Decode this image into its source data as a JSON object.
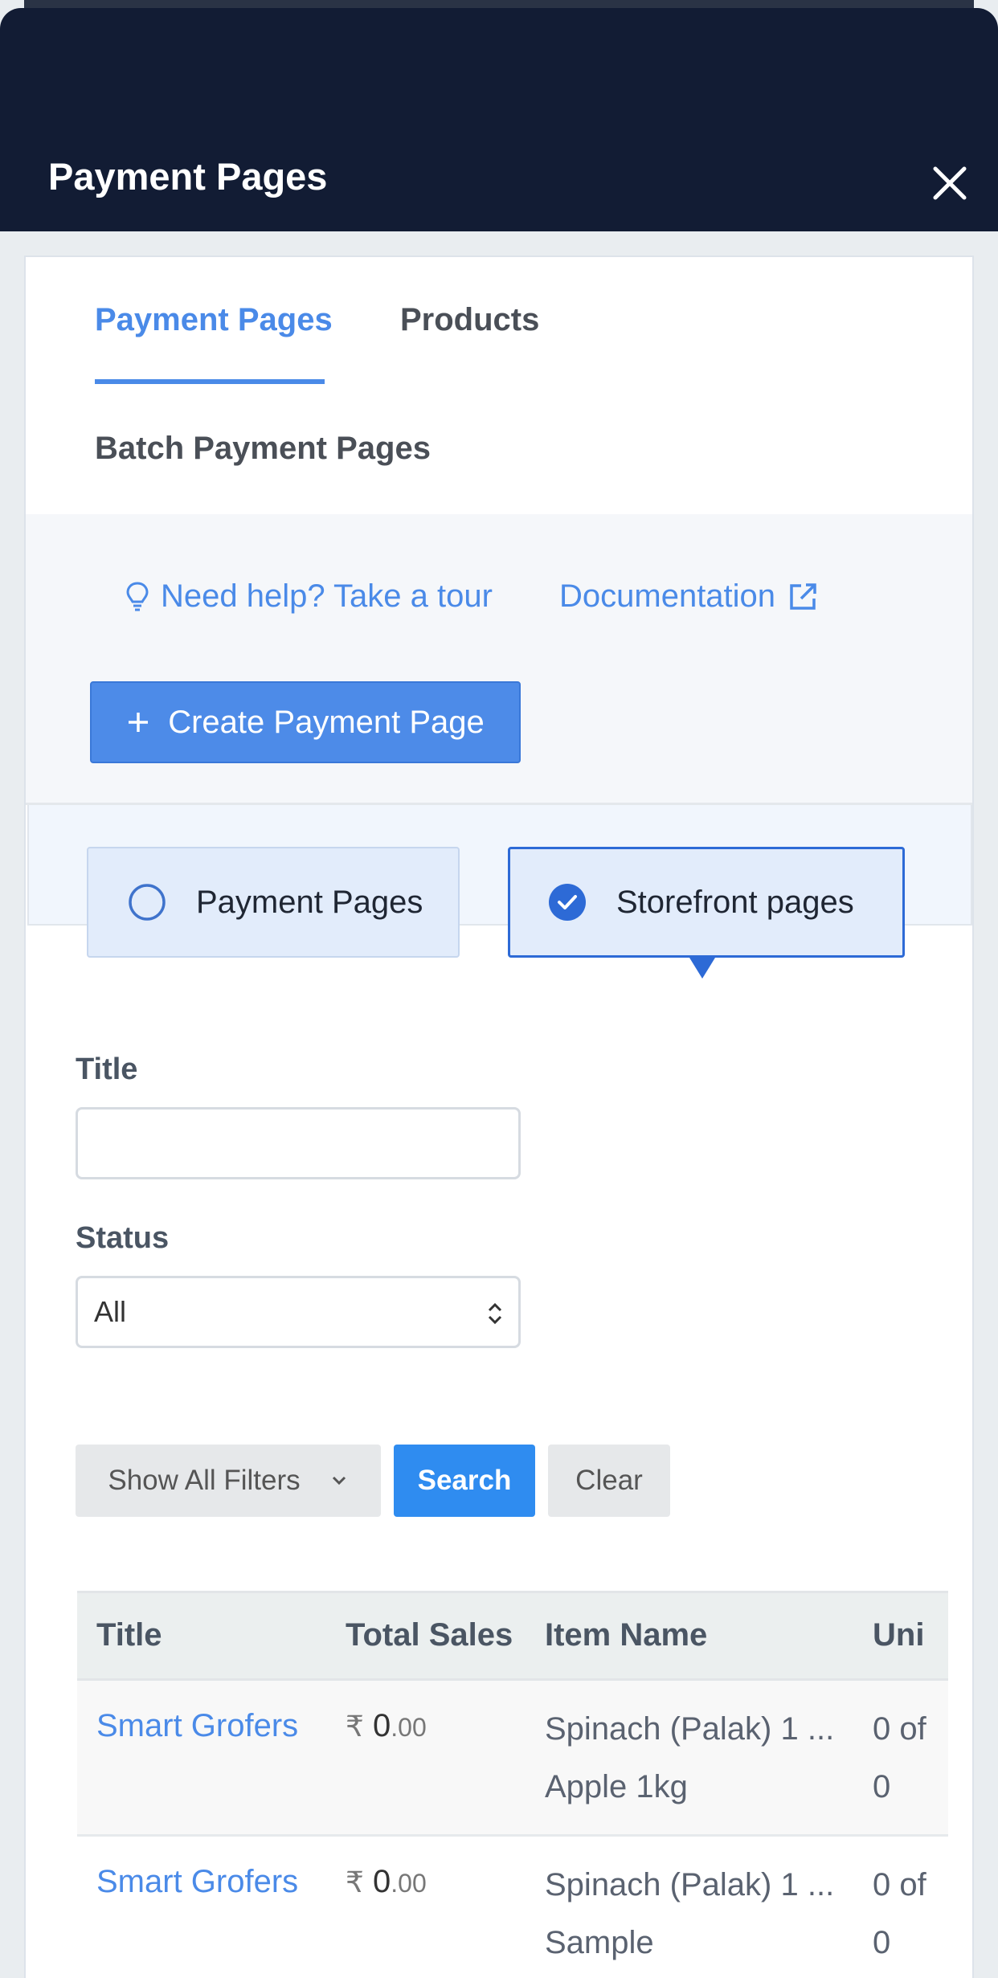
{
  "header": {
    "title": "Payment Pages"
  },
  "tabs": [
    {
      "label": "Payment Pages",
      "active": true
    },
    {
      "label": "Products",
      "active": false
    },
    {
      "label": "Batch Payment Pages",
      "active": false
    }
  ],
  "help": {
    "tour_label": "Need help? Take a tour",
    "docs_label": "Documentation",
    "create_label": "Create Payment Page"
  },
  "page_type_toggle": {
    "options": [
      {
        "label": "Payment Pages",
        "selected": false
      },
      {
        "label": "Storefront pages",
        "selected": true
      }
    ]
  },
  "filters": {
    "title_label": "Title",
    "title_value": "",
    "status_label": "Status",
    "status_value": "All",
    "show_filters_label": "Show All Filters",
    "search_label": "Search",
    "clear_label": "Clear"
  },
  "table": {
    "columns": [
      "Title",
      "Total Sales",
      "Item Name",
      "Uni"
    ],
    "rows": [
      {
        "title": "Smart Grofers",
        "currency": "₹",
        "sales_int": "0",
        "sales_dec": ".00",
        "item_1": "Spinach (Palak) 1 ...",
        "item_2": "Apple 1kg",
        "units_1": "0 of",
        "units_2": "0"
      },
      {
        "title": "Smart Grofers",
        "currency": "₹",
        "sales_int": "0",
        "sales_dec": ".00",
        "item_1": "Spinach (Palak) 1 ...",
        "item_2": "Sample",
        "units_1": "0 of",
        "units_2": "0"
      }
    ]
  },
  "colors": {
    "header_bg": "#121c34",
    "accent": "#4a8ae8",
    "primary_button": "#2f8cf0",
    "selected_toggle_border": "#2d6ad6"
  }
}
